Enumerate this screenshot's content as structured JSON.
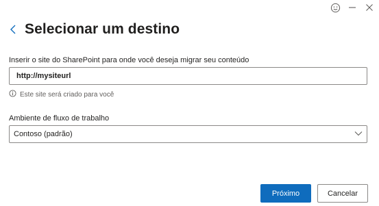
{
  "window": {
    "controls": {
      "feedback_icon": "smiley-icon",
      "minimize_icon": "minimize-icon",
      "close_icon": "close-icon"
    }
  },
  "header": {
    "back_icon": "chevron-left-icon",
    "title": "Selecionar um destino"
  },
  "site_field": {
    "label": "Inserir o site do SharePoint para onde você deseja migrar seu conteúdo",
    "value": "http://mysiteurl",
    "hint_icon": "info-icon",
    "hint": "Este site será criado para você"
  },
  "workflow_field": {
    "label": "Ambiente de fluxo de trabalho",
    "selected": "Contoso (padrão)",
    "dropdown_icon": "chevron-down-icon"
  },
  "footer": {
    "next_label": "Próximo",
    "cancel_label": "Cancelar"
  },
  "colors": {
    "accent": "#0f6cbd",
    "text": "#201f1e",
    "muted": "#605e5c",
    "border": "#8a8886"
  }
}
